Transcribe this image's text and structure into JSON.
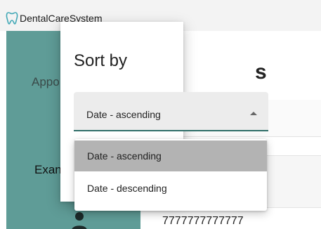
{
  "window": {
    "title": "DentalCareSystem",
    "icon": "tooth-icon",
    "accent": "#5f9c97"
  },
  "sidebar": {
    "items": [
      {
        "label": "Appo"
      },
      {
        "label": "Exan"
      }
    ],
    "profile_icon": "person-icon"
  },
  "main": {
    "heading_fragment": "s",
    "row_value": "7777777777777"
  },
  "sort_dialog": {
    "title": "Sort by",
    "selected_value": "Date - ascending",
    "options": [
      {
        "label": "Date - ascending",
        "selected": true
      },
      {
        "label": "Date - descending",
        "selected": false
      }
    ]
  }
}
